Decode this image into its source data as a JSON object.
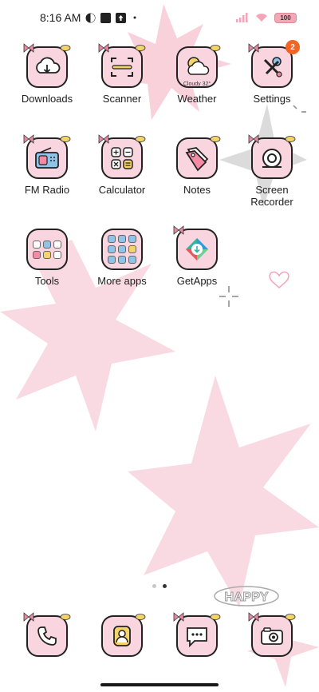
{
  "status_bar": {
    "time": "8:16 AM",
    "battery": "100",
    "icons": [
      "vpn-icon",
      "notification-square-icon",
      "upload-icon",
      "dot-icon",
      "signal-icon",
      "wifi-icon",
      "battery-icon"
    ]
  },
  "apps": [
    {
      "label": "Downloads",
      "icon": "cloud-download-icon"
    },
    {
      "label": "Scanner",
      "icon": "scan-frame-icon"
    },
    {
      "label": "Weather",
      "icon": "weather-cloud-sun-icon",
      "icon_text": "Cloudy 32°"
    },
    {
      "label": "Settings",
      "icon": "tools-settings-icon",
      "badge": "2"
    },
    {
      "label": "FM Radio",
      "icon": "radio-icon"
    },
    {
      "label": "Calculator",
      "icon": "calculator-icon"
    },
    {
      "label": "Notes",
      "icon": "notes-tag-icon"
    },
    {
      "label": "Screen Recorder",
      "icon": "screen-recorder-icon"
    },
    {
      "label": "Tools",
      "icon": "folder-icon"
    },
    {
      "label": "More apps",
      "icon": "folder-icon"
    },
    {
      "label": "GetApps",
      "icon": "getapps-icon"
    }
  ],
  "dock": [
    {
      "icon": "phone-icon"
    },
    {
      "icon": "contacts-icon"
    },
    {
      "icon": "messages-icon"
    },
    {
      "icon": "camera-icon"
    }
  ],
  "wallpaper_text": "HAPPY",
  "colors": {
    "icon_bg": "#f9d5df",
    "badge": "#f26522",
    "wallpaper_star": "#f7c6d2",
    "wallpaper_star_grey": "#bdbdbd"
  }
}
